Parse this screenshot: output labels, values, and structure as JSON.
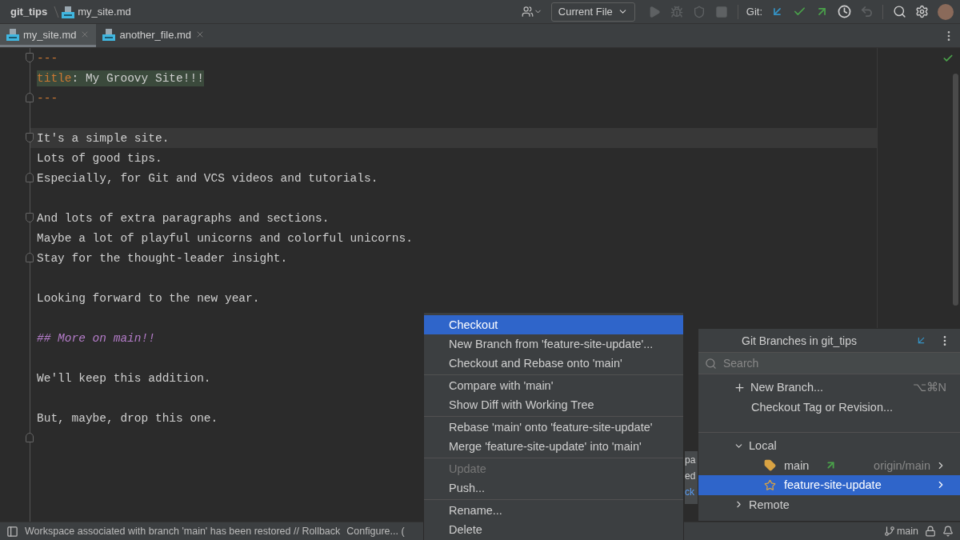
{
  "breadcrumbs": [
    {
      "label": "git_tips",
      "kind": "folder"
    },
    {
      "label": "my_site.md",
      "kind": "file"
    }
  ],
  "toolbar": {
    "run_config": "Current File",
    "git_label": "Git:",
    "run_actions": [
      {
        "kind": "run",
        "disabled": true
      },
      {
        "kind": "debug",
        "disabled": true
      },
      {
        "kind": "coverage",
        "disabled": true
      },
      {
        "kind": "stop",
        "disabled": true
      }
    ],
    "git_actions": [
      {
        "kind": "update",
        "disabled": false
      },
      {
        "kind": "commit",
        "disabled": false
      },
      {
        "kind": "push",
        "disabled": false
      },
      {
        "kind": "history",
        "disabled": false
      },
      {
        "kind": "rollback",
        "disabled": true
      }
    ]
  },
  "tabs": [
    {
      "label": "my_site.md",
      "selected": true
    },
    {
      "label": "another_file.md",
      "selected": false
    }
  ],
  "editor": {
    "lines": [
      {
        "kind": "delimiter",
        "text": "---",
        "fold_start": true,
        "current": false
      },
      {
        "kind": "property",
        "key": "title",
        "value": ": My Groovy Site!!!",
        "current": false
      },
      {
        "kind": "delimiter",
        "text": "---",
        "fold_end": true,
        "current": false
      },
      {
        "kind": "blank",
        "current": false
      },
      {
        "kind": "text",
        "text": "It's a simple site.",
        "fold_start": true,
        "current": true
      },
      {
        "kind": "text",
        "text": "Lots of good tips.",
        "current": false
      },
      {
        "kind": "text",
        "text": "Especially, for Git and VCS videos and tutorials.",
        "fold_end": true,
        "current": false
      },
      {
        "kind": "blank",
        "current": false
      },
      {
        "kind": "text",
        "text": "And lots of extra paragraphs and sections.",
        "fold_start": true,
        "current": false
      },
      {
        "kind": "text",
        "text": "Maybe a lot of playful unicorns and colorful unicorns.",
        "current": false
      },
      {
        "kind": "text",
        "text": "Stay for the thought-leader insight.",
        "fold_end": true,
        "current": false
      },
      {
        "kind": "blank",
        "current": false
      },
      {
        "kind": "text",
        "text": "Looking forward to the new year.",
        "current": false
      },
      {
        "kind": "blank",
        "current": false
      },
      {
        "kind": "heading",
        "text": "## More on main!!",
        "current": false
      },
      {
        "kind": "blank",
        "current": false
      },
      {
        "kind": "text",
        "text": "We'll keep this addition.",
        "current": false
      },
      {
        "kind": "blank",
        "current": false
      },
      {
        "kind": "text",
        "text": "But, maybe, drop this one.",
        "current": false
      },
      {
        "kind": "blank",
        "fold_end": true,
        "current": false
      }
    ]
  },
  "context_menu": {
    "groups": [
      [
        {
          "label": "Checkout",
          "selected": true,
          "disabled": false
        },
        {
          "label": "New Branch from 'feature-site-update'...",
          "selected": false,
          "disabled": false
        },
        {
          "label": "Checkout and Rebase onto 'main'",
          "selected": false,
          "disabled": false
        }
      ],
      [
        {
          "label": "Compare with 'main'",
          "selected": false,
          "disabled": false
        },
        {
          "label": "Show Diff with Working Tree",
          "selected": false,
          "disabled": false
        }
      ],
      [
        {
          "label": "Rebase 'main' onto 'feature-site-update'",
          "selected": false,
          "disabled": false
        },
        {
          "label": "Merge 'feature-site-update' into 'main'",
          "selected": false,
          "disabled": false
        }
      ],
      [
        {
          "label": "Update",
          "selected": false,
          "disabled": true
        },
        {
          "label": "Push...",
          "selected": false,
          "disabled": false
        }
      ],
      [
        {
          "label": "Rename...",
          "selected": false,
          "disabled": false
        },
        {
          "label": "Delete",
          "selected": false,
          "disabled": false
        }
      ]
    ]
  },
  "notification": {
    "fragments": [
      {
        "text": "pa",
        "kind": "text"
      },
      {
        "text": "ed",
        "kind": "text"
      },
      {
        "text": "ck",
        "kind": "link"
      }
    ]
  },
  "branches_popup": {
    "title": "Git Branches in git_tips",
    "search": {
      "placeholder": "Search"
    },
    "actions": [
      {
        "label": "New Branch...",
        "shortcut": "⌥⌘N",
        "kind": "new"
      },
      {
        "label": "Checkout Tag or Revision...",
        "kind": "plain"
      }
    ],
    "groups": [
      {
        "label": "Local",
        "expanded": true,
        "children": [
          {
            "label": "main",
            "kind": "current",
            "outgoing": true,
            "tracking": "origin/main",
            "selected": false
          },
          {
            "label": "feature-site-update",
            "kind": "favorite",
            "outgoing": false,
            "selected": true
          }
        ]
      },
      {
        "label": "Remote",
        "expanded": false
      }
    ]
  },
  "status_bar": {
    "message": "Workspace associated with branch 'main' has been restored // Rollback",
    "link": "Configure... (",
    "branch": "main"
  }
}
